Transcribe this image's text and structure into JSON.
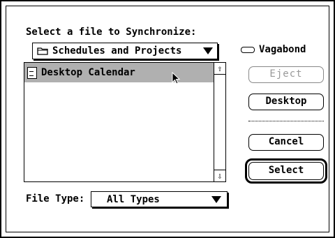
{
  "dialog": {
    "prompt": "Select a file to Synchronize:",
    "folder_popup": {
      "value": "Schedules and Projects",
      "icon": "folder-icon"
    },
    "volume": {
      "label": "Vagabond",
      "icon": "disk-icon"
    },
    "file_list": [
      {
        "name": "Desktop Calendar",
        "icon": "document-icon",
        "selected": true
      }
    ],
    "buttons": {
      "eject": "Eject",
      "desktop": "Desktop",
      "cancel": "Cancel",
      "select": "Select"
    },
    "file_type": {
      "label": "File Type:",
      "value": "All Types"
    },
    "colors": {
      "selection": "#b0b0b0",
      "disabled": "#999999"
    }
  }
}
